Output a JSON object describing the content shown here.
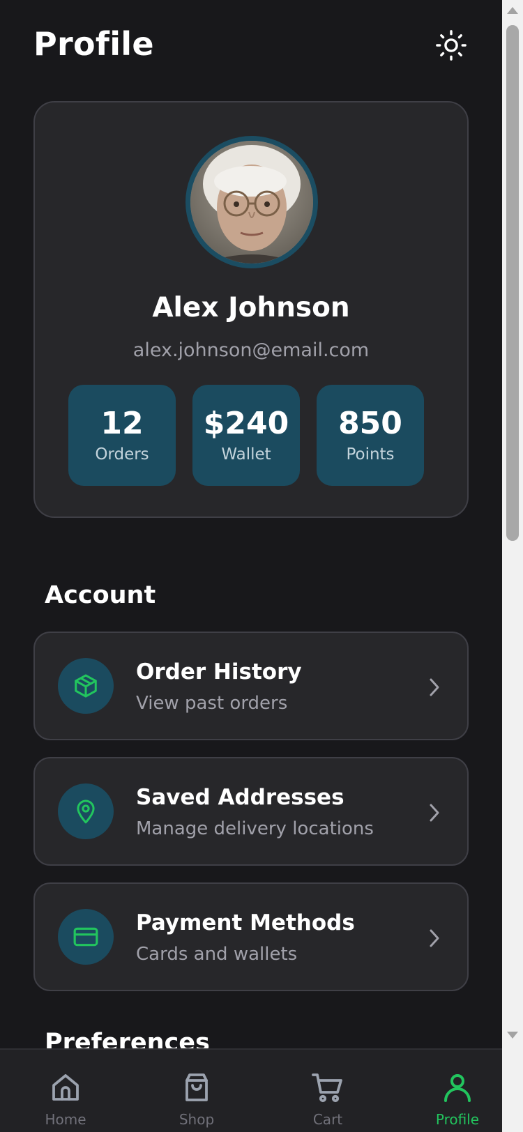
{
  "header": {
    "title": "Profile",
    "theme_icon": "sun-icon"
  },
  "profile": {
    "name": "Alex Johnson",
    "email": "alex.johnson@email.com",
    "stats": [
      {
        "value": "12",
        "label": "Orders"
      },
      {
        "value": "$240",
        "label": "Wallet"
      },
      {
        "value": "850",
        "label": "Points"
      }
    ]
  },
  "account": {
    "title": "Account",
    "items": [
      {
        "title": "Order History",
        "subtitle": "View past orders",
        "icon": "package-icon"
      },
      {
        "title": "Saved Addresses",
        "subtitle": "Manage delivery locations",
        "icon": "map-pin-icon"
      },
      {
        "title": "Payment Methods",
        "subtitle": "Cards and wallets",
        "icon": "credit-card-icon"
      }
    ]
  },
  "preferences": {
    "title": "Preferences"
  },
  "nav": {
    "items": [
      {
        "label": "Home",
        "icon": "home-icon",
        "active": false
      },
      {
        "label": "Shop",
        "icon": "shopping-bag-icon",
        "active": false
      },
      {
        "label": "Cart",
        "icon": "cart-icon",
        "active": false
      },
      {
        "label": "Profile",
        "icon": "user-icon",
        "active": true
      }
    ]
  },
  "colors": {
    "accent": "#22c55e",
    "tile": "#1b4b5f",
    "background": "#18181b",
    "card": "#27272a"
  }
}
